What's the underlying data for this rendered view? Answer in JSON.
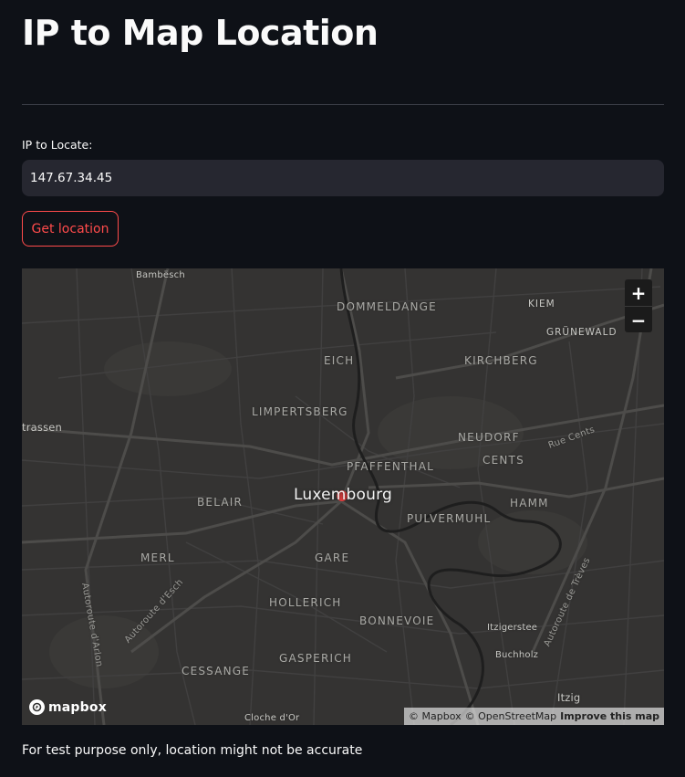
{
  "header": {
    "title": "IP to Map Location"
  },
  "form": {
    "label": "IP to Locate:",
    "ip_value": "147.67.34.45",
    "button_label": "Get location"
  },
  "map": {
    "city_label": "Luxembourg",
    "districts": {
      "dommeldange": "DOMMELDANGE",
      "kiem": "KIEM",
      "grunewald": "GRÜNEWALD",
      "eich": "EICH",
      "kirchberg": "KIRCHBERG",
      "limpertsberg": "LIMPERTSBERG",
      "neudorf": "NEUDORF",
      "cents": "CENTS",
      "pfaffenthal": "PFAFFENTHAL",
      "belair": "BELAIR",
      "hamm": "HAMM",
      "pulvermuhl": "PULVERMUHL",
      "merl": "MERL",
      "gare": "GARE",
      "hollerich": "HOLLERICH",
      "bonnevoie": "BONNEVOIE",
      "gasperich": "GASPERICH",
      "cessange": "CESSANGE"
    },
    "places": {
      "bambesch": "Bambësch",
      "strassen": "trassen",
      "itzigerstee": "Itzigerstee",
      "buchholz": "Buchholz",
      "itzig": "Itzig"
    },
    "roads": {
      "rue_cents": "Rue Cents",
      "autoroute_esch": "Autoroute d'Esch",
      "autoroute_arlon": "Autoroute d'Arlon",
      "autoroute_treves": "Autoroute de Trèves",
      "cloche_dor": "Cloche d'Or"
    },
    "zoom_in": "+",
    "zoom_out": "−",
    "logo_text": "mapbox",
    "attribution": {
      "mapbox": "© Mapbox",
      "osm": "© OpenStreetMap",
      "improve": "Improve this map"
    },
    "colors": {
      "background": "#343332",
      "roads": "#4a4947",
      "river": "#1e1e1e",
      "marker": "#ff3c3c"
    }
  },
  "footer": {
    "note": "For test purpose only, location might not be accurate"
  },
  "theme": {
    "background": "#0e1117",
    "accent": "#ff4b4b",
    "input_bg": "#262730"
  }
}
